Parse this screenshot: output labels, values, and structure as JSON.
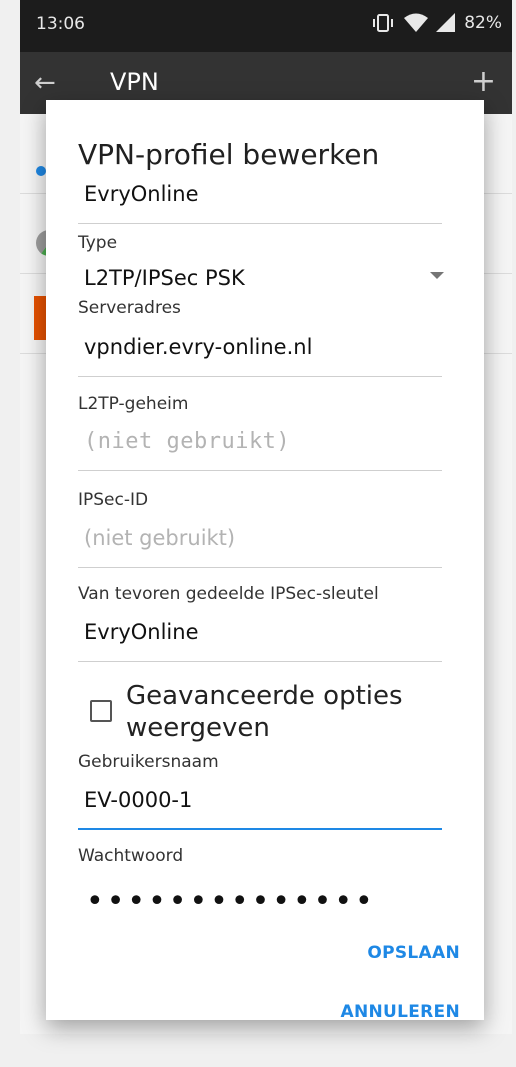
{
  "status_bar": {
    "time": "13:06",
    "battery": "82%"
  },
  "app_bar": {
    "back_icon": "←",
    "title": "VPN",
    "add_icon": "+"
  },
  "dialog": {
    "title": "VPN-profiel bewerken",
    "name_value": "EvryOnline",
    "type_label": "Type",
    "type_value": "L2TP/IPSec PSK",
    "server_label": "Serveradres",
    "server_value": "vpndier.evry-online.nl",
    "l2tp_label": "L2TP-geheim",
    "l2tp_placeholder": "(niet gebruikt)",
    "ipsec_id_label": "IPSec-ID",
    "ipsec_id_placeholder": "(niet gebruikt)",
    "psk_label": "Van tevoren gedeelde IPSec-sleutel",
    "psk_value": "EvryOnline",
    "advanced_label": "Geavanceerde opties weergeven",
    "advanced_checked": false,
    "username_label": "Gebruikersnaam",
    "username_value": "EV-0000-1",
    "password_label": "Wachtwoord",
    "password_value": "••••••••••••••",
    "save_label": "OPSLAAN",
    "cancel_label": "ANNULEREN"
  },
  "colors": {
    "accent": "#1e88e5",
    "appbar": "#333333",
    "statusbar": "#1c1c1c"
  }
}
